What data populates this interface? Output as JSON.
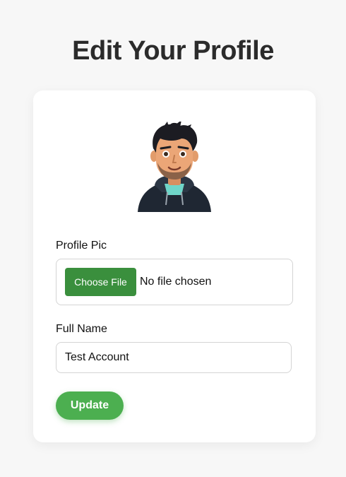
{
  "page": {
    "title": "Edit Your Profile"
  },
  "form": {
    "profile_pic_label": "Profile Pic",
    "choose_file_label": "Choose File",
    "file_status": "No file chosen",
    "full_name_label": "Full Name",
    "full_name_value": "Test Account",
    "update_label": "Update"
  },
  "avatar": {
    "icon": "avatar-icon"
  },
  "colors": {
    "choose_file_bg": "#3a8f3d",
    "update_bg": "#4caf50",
    "title": "#2b2b2b"
  }
}
